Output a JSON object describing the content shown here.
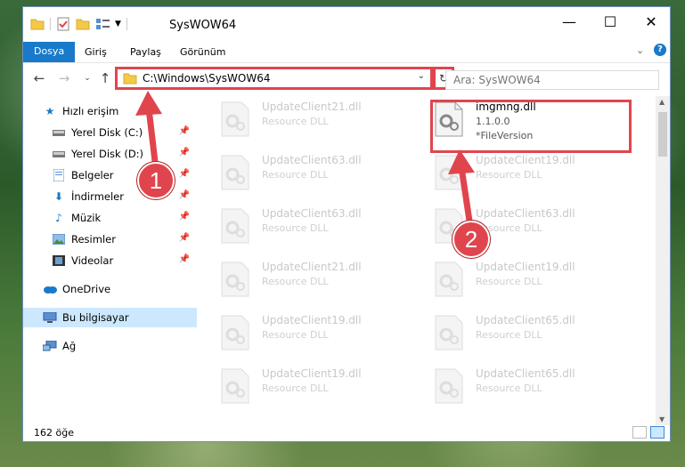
{
  "window": {
    "title": "SysWOW64",
    "controls": {
      "minimize": "—",
      "maximize": "☐",
      "close": "✕"
    }
  },
  "ribbon": {
    "tabs": [
      {
        "label": "Dosya",
        "active": true
      },
      {
        "label": "Giriş",
        "active": false
      },
      {
        "label": "Paylaş",
        "active": false
      },
      {
        "label": "Görünüm",
        "active": false
      }
    ],
    "help": "?"
  },
  "address": {
    "path": "C:\\Windows\\SysWOW64",
    "search_placeholder": "Ara: SysWOW64"
  },
  "nav": {
    "items": [
      {
        "label": "Hızlı erişim",
        "icon": "star-icon",
        "pinned": false,
        "selected": false
      },
      {
        "label": "Yerel Disk (C:)",
        "icon": "drive-icon",
        "pinned": true,
        "selected": false
      },
      {
        "label": "Yerel Disk (D:)",
        "icon": "drive-icon",
        "pinned": true,
        "selected": false
      },
      {
        "label": "Belgeler",
        "icon": "documents-icon",
        "pinned": true,
        "selected": false
      },
      {
        "label": "İndirmeler",
        "icon": "download-icon",
        "pinned": true,
        "selected": false
      },
      {
        "label": "Müzik",
        "icon": "music-icon",
        "pinned": true,
        "selected": false
      },
      {
        "label": "Resimler",
        "icon": "pictures-icon",
        "pinned": true,
        "selected": false
      },
      {
        "label": "Videolar",
        "icon": "video-icon",
        "pinned": true,
        "selected": false
      },
      {
        "label": "OneDrive",
        "icon": "cloud-icon",
        "pinned": false,
        "selected": false
      },
      {
        "label": "Bu bilgisayar",
        "icon": "computer-icon",
        "pinned": false,
        "selected": true
      },
      {
        "label": "Ağ",
        "icon": "network-icon",
        "pinned": false,
        "selected": false
      }
    ]
  },
  "files": [
    {
      "name": "UpdateClient21.dll",
      "sub": "Resource DLL",
      "faded": true
    },
    {
      "name": "imgmng.dll",
      "sub": "1.1.0.0",
      "sub2": "*FileVersion",
      "faded": false
    },
    {
      "name": "UpdateClient63.dll",
      "sub": "Resource DLL",
      "faded": true
    },
    {
      "name": "UpdateClient19.dll",
      "sub": "Resource DLL",
      "faded": true
    },
    {
      "name": "UpdateClient63.dll",
      "sub": "Resource DLL",
      "faded": true
    },
    {
      "name": "UpdateClient63.dll",
      "sub": "Resource DLL",
      "faded": true
    },
    {
      "name": "UpdateClient21.dll",
      "sub": "Resource DLL",
      "faded": true
    },
    {
      "name": "UpdateClient19.dll",
      "sub": "Resource DLL",
      "faded": true
    },
    {
      "name": "UpdateClient19.dll",
      "sub": "Resource DLL",
      "faded": true
    },
    {
      "name": "UpdateClient65.dll",
      "sub": "Resource DLL",
      "faded": true
    },
    {
      "name": "UpdateClient19.dll",
      "sub": "Resource DLL",
      "faded": true
    },
    {
      "name": "UpdateClient65.dll",
      "sub": "Resource DLL",
      "faded": true
    }
  ],
  "status": {
    "count": "162 öğe"
  },
  "markers": [
    "1",
    "2"
  ],
  "colors": {
    "accent": "#1979ca",
    "highlight": "#e0454e",
    "selection": "#cce8ff"
  }
}
